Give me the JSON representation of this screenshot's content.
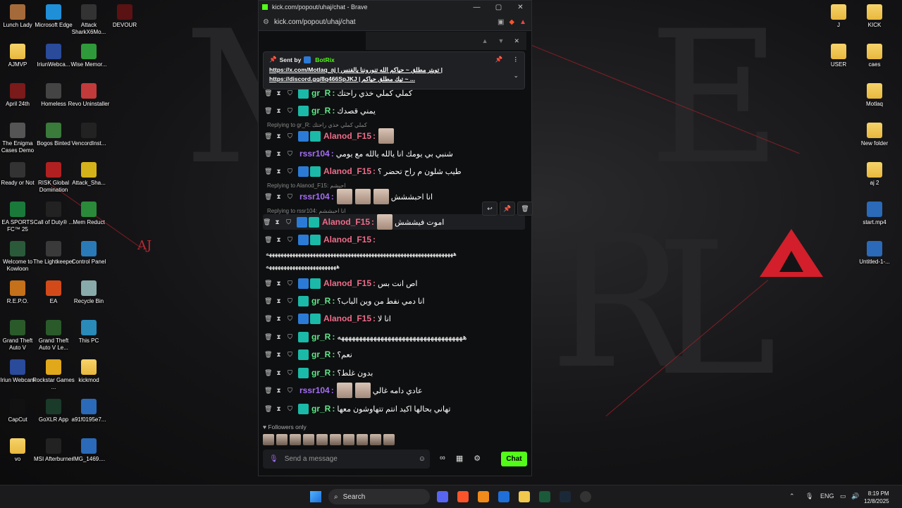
{
  "window": {
    "title": "kick.com/popout/uhaj/chat - Brave",
    "url": "kick.com/popout/uhaj/chat",
    "controls": [
      "—",
      "▢",
      "✕"
    ]
  },
  "pinned": {
    "sent_by_label": "Sent by",
    "sender": "BotRix",
    "line1": "https://x.com/Motlaq_aj | تويتر مطلق ~ حياكم الله تنوروننا بالفنس |",
    "line2": "https://discord.gg/8q466SpJKJ | تيك مطلق حياكم ~ ..."
  },
  "messages": [
    {
      "user": "gr_R",
      "text": "كملي كملي خذي راحتك",
      "color": "green",
      "badges": [
        "teal"
      ]
    },
    {
      "user": "gr_R",
      "text": "يمني قصدك",
      "color": "green",
      "badges": [
        "teal"
      ]
    },
    {
      "user": "Alanod_F15",
      "text": "",
      "color": "pink",
      "badges": [
        "blue",
        "teal"
      ],
      "reply": "Replying to gr_R: كملي كملي خذي راحتك",
      "emotes": 1
    },
    {
      "user": "rssr104",
      "text": "شنبي بي يومك انا يالله يالله مع يومي",
      "color": "purple",
      "badges": []
    },
    {
      "user": "Alanod_F15",
      "text": "طيب شلون م راح تحضر ؟",
      "color": "pink",
      "badges": [
        "blue",
        "teal"
      ]
    },
    {
      "user": "rssr104",
      "text": "انا احبششش",
      "color": "purple",
      "badges": [],
      "reply": "Replying to Alanod_F15: احبشم",
      "emotes": 3
    },
    {
      "user": "Alanod_F15",
      "text": "اموت فيششش",
      "color": "pink",
      "badges": [
        "blue",
        "teal"
      ],
      "reply": "Replying to rssr104: انا احبششم",
      "emotes": 1,
      "highlight": true
    },
    {
      "user": "Alanod_F15",
      "text": "",
      "color": "pink",
      "badges": [
        "blue",
        "teal"
      ]
    },
    {
      "user": "Alanod_F15",
      "text": "اص انت بس",
      "color": "pink",
      "badges": [
        "blue",
        "teal"
      ]
    },
    {
      "user": "gr_R",
      "text": "انا دمي نفط من وين الباب؟",
      "color": "green",
      "badges": [
        "teal"
      ]
    },
    {
      "user": "Alanod_F15",
      "text": "انا لا",
      "color": "pink",
      "badges": [
        "blue",
        "teal"
      ]
    },
    {
      "user": "gr_R",
      "text": "هههههههههههههههههههههههههههههههههههه",
      "color": "green",
      "badges": [
        "teal"
      ]
    },
    {
      "user": "gr_R",
      "text": "نعم؟",
      "color": "green",
      "badges": [
        "teal"
      ]
    },
    {
      "user": "gr_R",
      "text": "بدون غلط؟",
      "color": "green",
      "badges": [
        "teal"
      ]
    },
    {
      "user": "rssr104",
      "text": "عادي دامه غالي",
      "color": "purple",
      "badges": [],
      "emotes": 2
    },
    {
      "user": "gr_R",
      "text": "تهاني بحالها اكيد انتم تتهاوشون معها",
      "color": "green",
      "badges": [
        "teal"
      ]
    }
  ],
  "long_laugh_1": "ههههههههههههههههههههههههههههههههههههههههههههههههههههههههههههههههه",
  "long_laugh_2": "ههههههههههههههههههههههههه",
  "followers_label": "Followers only",
  "input_placeholder": "Send a message",
  "chat_button": "Chat",
  "desktop_left": [
    {
      "label": "Lunch Lady",
      "color": "#a56a3a"
    },
    {
      "label": "Microsoft Edge",
      "color": "#1f8fd8"
    },
    {
      "label": "Attack SharkX6Mo...",
      "color": "#333"
    },
    {
      "label": "DEVOUR",
      "color": "#5a1212"
    },
    {
      "label": "AJMVP",
      "color": "folder"
    },
    {
      "label": "IriunWebca...",
      "color": "#2a4a9a"
    },
    {
      "label": "Wise Memor...",
      "color": "#2f9a3a"
    },
    {
      "label": "April 24th",
      "color": "#7a1a1a"
    },
    {
      "label": "Homeless",
      "color": "#444"
    },
    {
      "label": "Revo Uninstaller",
      "color": "#c23a3a"
    },
    {
      "label": "The Enigma Cases Demo",
      "color": "#555"
    },
    {
      "label": "Bogos Binted",
      "color": "#3a7a3a"
    },
    {
      "label": "VencordInst...",
      "color": "#222"
    },
    {
      "label": "Ready or Not",
      "color": "#333"
    },
    {
      "label": "RISK Global Domination",
      "color": "#b02020"
    },
    {
      "label": "Attack_Sha...",
      "color": "#d4b21a"
    },
    {
      "label": "EA SPORTS FC™ 25",
      "color": "#1a7a3a"
    },
    {
      "label": "Call of Duty® ...",
      "color": "#222"
    },
    {
      "label": "Mem Reduct",
      "color": "#2a8a3a"
    },
    {
      "label": "Welcome to Kowloon",
      "color": "#2a5a3a"
    },
    {
      "label": "The Lightkeeper",
      "color": "#3a3a3a"
    },
    {
      "label": "Control Panel",
      "color": "#2a7ab8"
    },
    {
      "label": "R.E.P.O.",
      "color": "#c5701a"
    },
    {
      "label": "EA",
      "color": "#d24a1a"
    },
    {
      "label": "Recycle Bin",
      "color": "#8aa"
    },
    {
      "label": "Grand Theft Auto V",
      "color": "#2a5a2a"
    },
    {
      "label": "Grand Theft Auto V Le...",
      "color": "#2a5a2a"
    },
    {
      "label": "This PC",
      "color": "#2a8ab8"
    },
    {
      "label": "Iriun Webcam",
      "color": "#2a4a9a"
    },
    {
      "label": "Rockstar Games ...",
      "color": "#e0a81a"
    },
    {
      "label": "kickmod",
      "color": "folder"
    },
    {
      "label": "CapCut",
      "color": "#111"
    },
    {
      "label": "GoXLR App",
      "color": "#1a3a2a"
    },
    {
      "label": "a91f0195e7...",
      "color": "#2a6ab8"
    },
    {
      "label": "vo",
      "color": "folder"
    },
    {
      "label": "MSI Afterburner",
      "color": "#222"
    },
    {
      "label": "IMG_1469....",
      "color": "#2a6ab8"
    }
  ],
  "desktop_right": [
    {
      "label": "J",
      "color": "folder"
    },
    {
      "label": "KICK",
      "color": "folder"
    },
    {
      "label": "USER",
      "color": "folder"
    },
    {
      "label": "caes",
      "color": "folder"
    },
    {
      "label": "Motlaq",
      "color": "folder"
    },
    {
      "label": "New folder",
      "color": "folder"
    },
    {
      "label": "aj 2",
      "color": "folder"
    },
    {
      "label": "start.mp4",
      "color": "#2a6ab8"
    },
    {
      "label": "Untitled-1-...",
      "color": "#2a6ab8"
    }
  ],
  "taskbar": {
    "search": "Search",
    "lang": "ENG",
    "time": "8:19 PM",
    "date": "12/8/2025"
  }
}
